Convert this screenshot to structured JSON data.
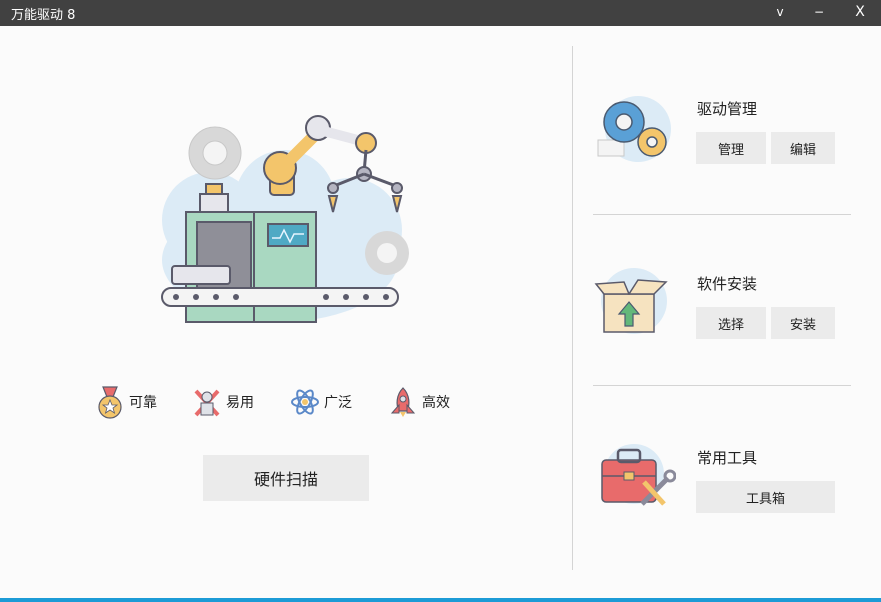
{
  "window": {
    "title": "万能驱动 8",
    "btn_min": "v",
    "btn_mid": "−",
    "btn_close": "X"
  },
  "features": [
    {
      "label": "可靠",
      "icon": "medal-icon"
    },
    {
      "label": "易用",
      "icon": "tools-cross-icon"
    },
    {
      "label": "广泛",
      "icon": "atom-icon"
    },
    {
      "label": "高效",
      "icon": "rocket-icon"
    }
  ],
  "scan_button": "硬件扫描",
  "sections": {
    "driver": {
      "title": "驱动管理",
      "btn1": "管理",
      "btn2": "编辑"
    },
    "software": {
      "title": "软件安装",
      "btn1": "选择",
      "btn2": "安装"
    },
    "tools": {
      "title": "常用工具",
      "btn1": "工具箱"
    }
  },
  "colors": {
    "titlebar": "#414141",
    "accent_bar": "#1c9bd6",
    "button_bg": "#ebebeb"
  }
}
